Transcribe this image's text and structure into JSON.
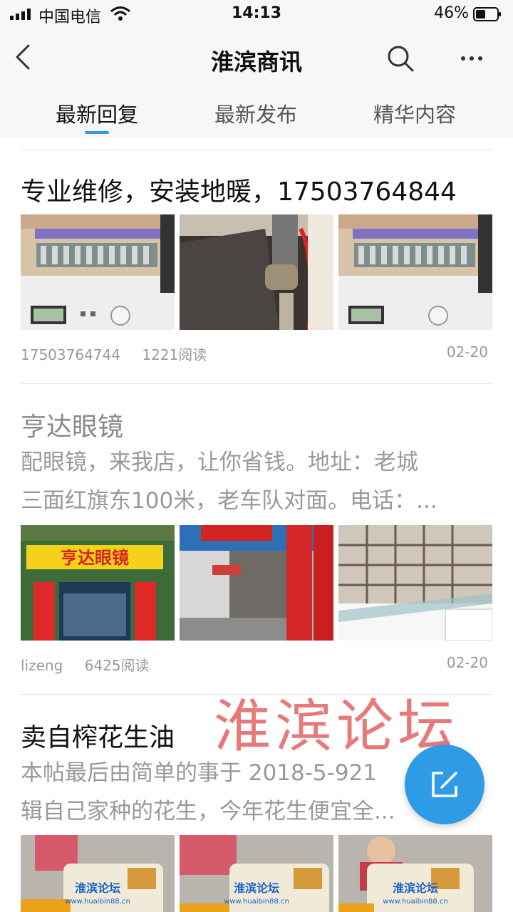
{
  "status_bar": {
    "carrier": "中国电信",
    "time": "14:13",
    "battery_percent": "46%",
    "battery_level": 0.46
  },
  "nav": {
    "title": "淮滨商讯",
    "back_icon": "chevron-left-icon",
    "search_icon": "search-icon",
    "more_icon": "more-horizontal-icon"
  },
  "tabs": [
    {
      "label": "最新回复",
      "active": true
    },
    {
      "label": "最新发布",
      "active": false
    },
    {
      "label": "精华内容",
      "active": false
    }
  ],
  "accent_color": "#2d9be6",
  "posts": [
    {
      "title": "专业维修，安装地暖，17503764844",
      "author": "17503764744",
      "reads": "1221阅读",
      "date": "02-20",
      "images": [
        "boiler-burner-photo",
        "boiler-pipe-photo",
        "boiler-burner-photo"
      ]
    },
    {
      "title": "亨达眼镜",
      "excerpt": [
        "配眼镜，来我店，让你省钱。地址：老城",
        "三面红旗东100米，老车队对面。电话：..."
      ],
      "author": "lizeng",
      "reads": "6425阅读",
      "date": "02-20",
      "images": [
        "storefront-photo",
        "street-signs-photo",
        "eyeglass-display-photo"
      ]
    },
    {
      "title": "卖自榨花生油",
      "excerpt": [
        "本帖最后由简单的事于 2018-5-921",
        "辑自己家种的花生，今年花生便宜全..."
      ],
      "images": [
        "peanut-oil-photo",
        "peanut-oil-photo",
        "peanut-oil-photo"
      ]
    }
  ],
  "watermark_text": "淮滨论坛",
  "thumb_watermark": "淮滨论坛",
  "thumb_watermark_url": "www.huaibin88.cn",
  "fab_icon": "compose-icon"
}
